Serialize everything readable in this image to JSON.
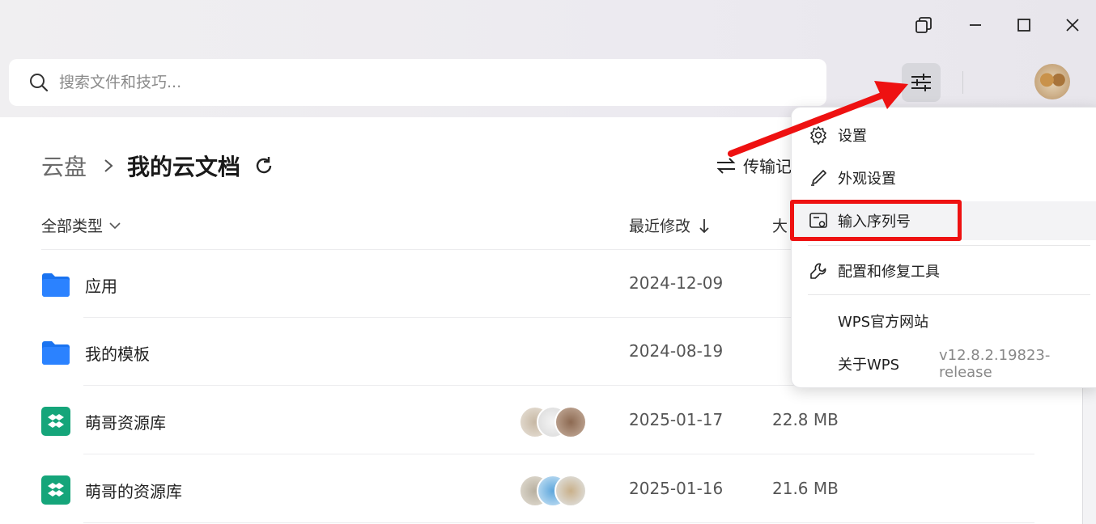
{
  "search": {
    "placeholder": "搜索文件和技巧..."
  },
  "breadcrumb": {
    "root": "云盘",
    "current": "我的云文档"
  },
  "toolbar": {
    "transfer_label": "传输记"
  },
  "columns": {
    "type_filter": "全部类型",
    "modified": "最近修改",
    "size": "大"
  },
  "files": [
    {
      "name": "应用",
      "date": "2024-12-09",
      "size": "",
      "kind": "folder"
    },
    {
      "name": "我的模板",
      "date": "2024-08-19",
      "size": "",
      "kind": "folder"
    },
    {
      "name": "萌哥资源库",
      "date": "2025-01-17",
      "size": "22.8 MB",
      "kind": "shared-space"
    },
    {
      "name": "萌哥的资源库",
      "date": "2025-01-16",
      "size": "21.6 MB",
      "kind": "shared-space"
    }
  ],
  "menu": {
    "settings": "设置",
    "appearance": "外观设置",
    "serial": "输入序列号",
    "repair": "配置和修复工具",
    "website": "WPS官方网站",
    "about": "关于WPS",
    "version": "v12.8.2.19823-release"
  },
  "colors": {
    "folder": "#1a73f0",
    "shared": "#15a57a",
    "highlight": "#ee1111",
    "accent": "#1f1f1f"
  },
  "icons": [
    "search-icon",
    "chevron-right-icon",
    "refresh-icon",
    "transfer-icon",
    "chevron-down-icon",
    "arrow-down-icon",
    "folder-icon",
    "shared-space-icon",
    "gear-icon",
    "brush-icon",
    "serial-key-icon",
    "wrench-icon",
    "restore-window-icon",
    "maximize-icon",
    "close-icon",
    "filter-sliders-icon"
  ]
}
